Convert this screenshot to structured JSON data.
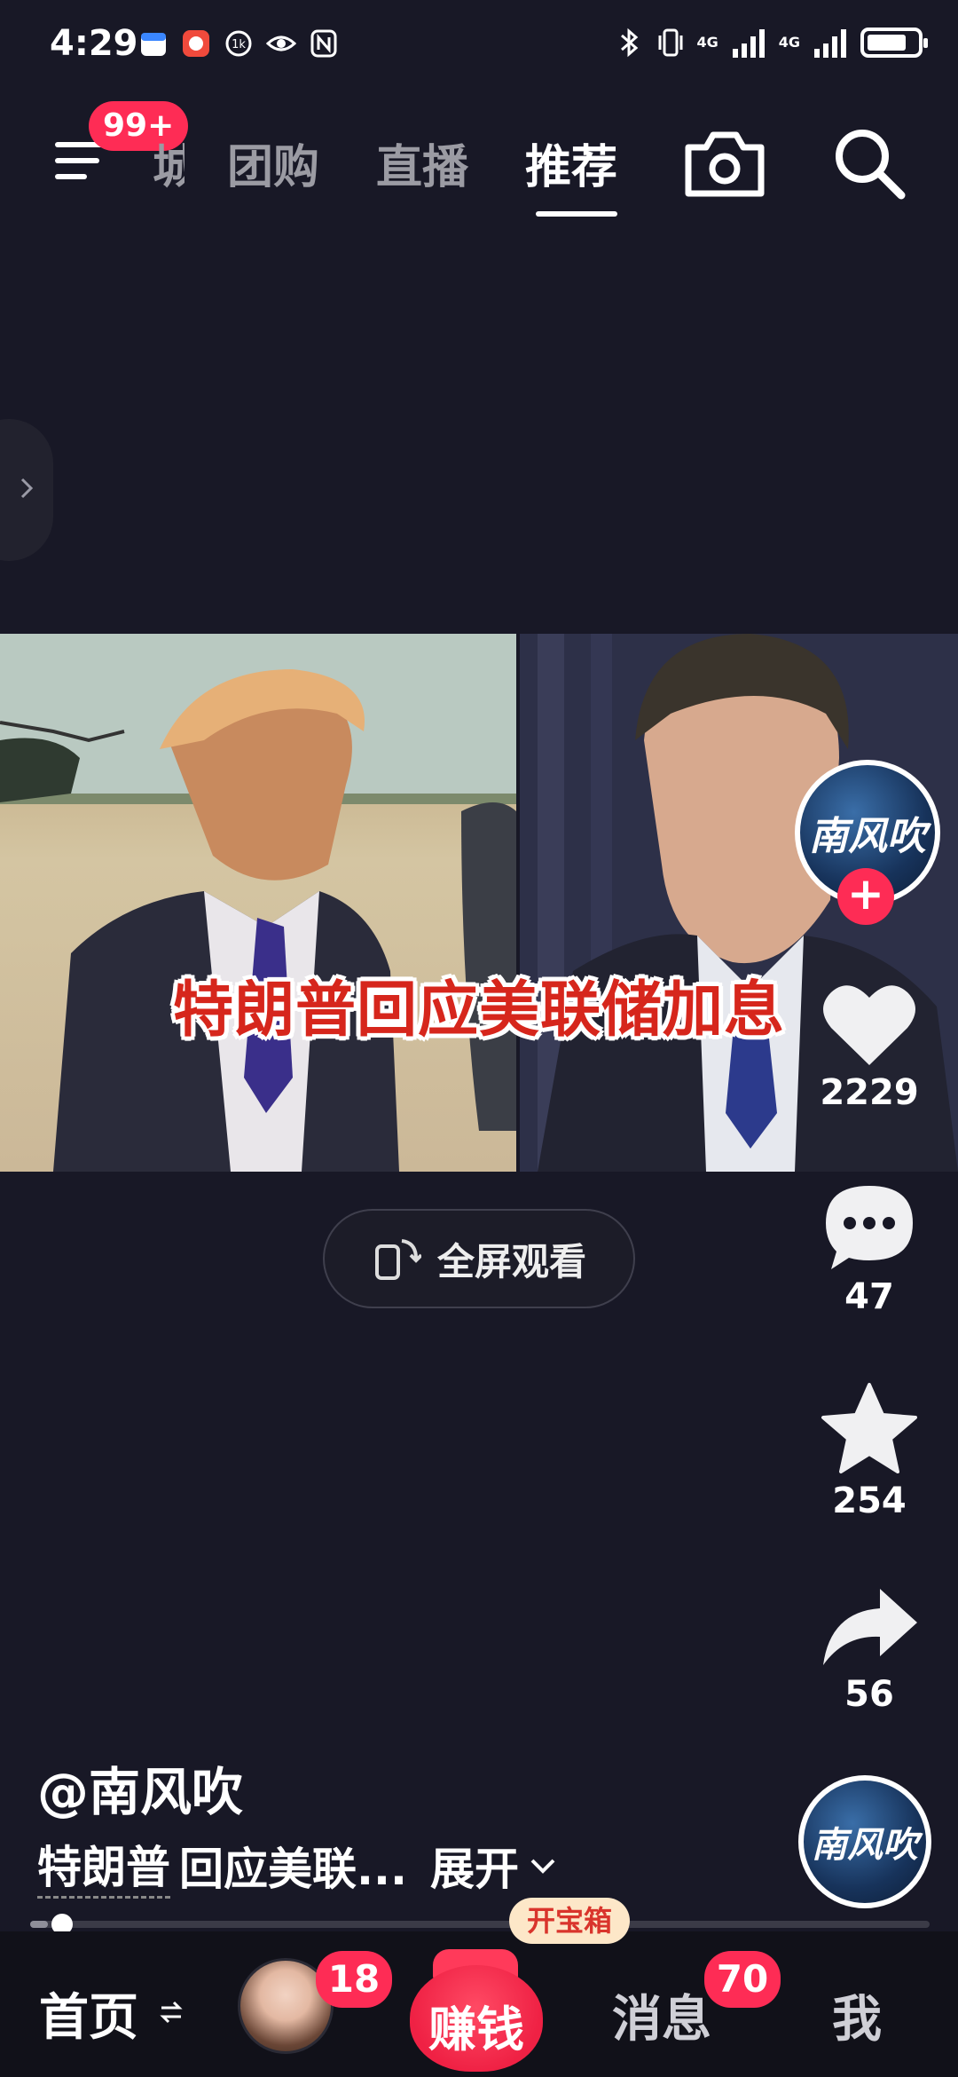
{
  "status_bar": {
    "time": "4:29",
    "network_1": "4G",
    "network_2": "4G",
    "battery_level": 0.8
  },
  "top_nav": {
    "menu_badge": "99+",
    "tabs": [
      {
        "label": "团购",
        "active": false
      },
      {
        "label": "直播",
        "active": false
      },
      {
        "label": "推荐",
        "active": true
      }
    ],
    "partial_tab": "城"
  },
  "video": {
    "caption": "特朗普回应美联储加息",
    "fullscreen_label": "全屏观看"
  },
  "author_avatar_text": "南风吹",
  "actions": {
    "likes": "2229",
    "comments": "47",
    "favorites": "254",
    "shares": "56"
  },
  "post": {
    "author": "@南风吹",
    "tag": "特朗普",
    "text": "回应美联...",
    "expand_label": "展开"
  },
  "progress": 0.02,
  "tabbar": {
    "home_label": "首页",
    "friend_badge": "18",
    "earn_label": "赚钱",
    "treasure_label": "开宝箱",
    "message_label": "消息",
    "message_badge": "70",
    "me_label": "我"
  },
  "colors": {
    "accent": "#fe2c55",
    "background": "#181826"
  }
}
